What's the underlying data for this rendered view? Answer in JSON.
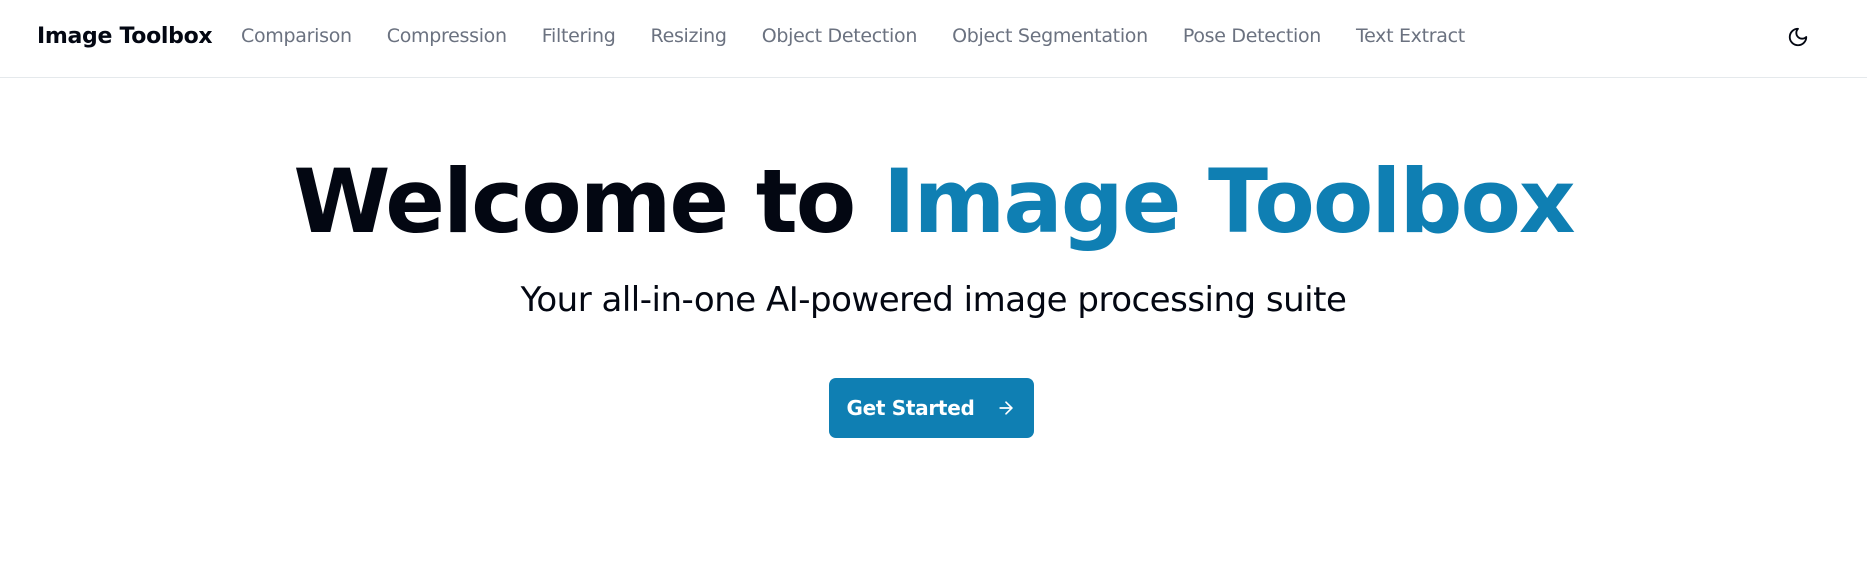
{
  "app": {
    "brand": "Image Toolbox"
  },
  "nav": {
    "items": [
      {
        "label": "Comparison"
      },
      {
        "label": "Compression"
      },
      {
        "label": "Filtering"
      },
      {
        "label": "Resizing"
      },
      {
        "label": "Object Detection"
      },
      {
        "label": "Object Segmentation"
      },
      {
        "label": "Pose Detection"
      },
      {
        "label": "Text Extract"
      }
    ],
    "theme_toggle_icon": "moon-icon"
  },
  "hero": {
    "title_prefix": "Welcome to ",
    "title_accent": "Image Toolbox",
    "subtitle": "Your all-in-one AI-powered image processing suite",
    "cta_label": "Get Started",
    "cta_icon": "arrow-right-icon"
  },
  "colors": {
    "accent": "#0f7fb3",
    "text_dark": "#030712",
    "nav_text": "#6b7280",
    "border": "#e5e9ec"
  }
}
